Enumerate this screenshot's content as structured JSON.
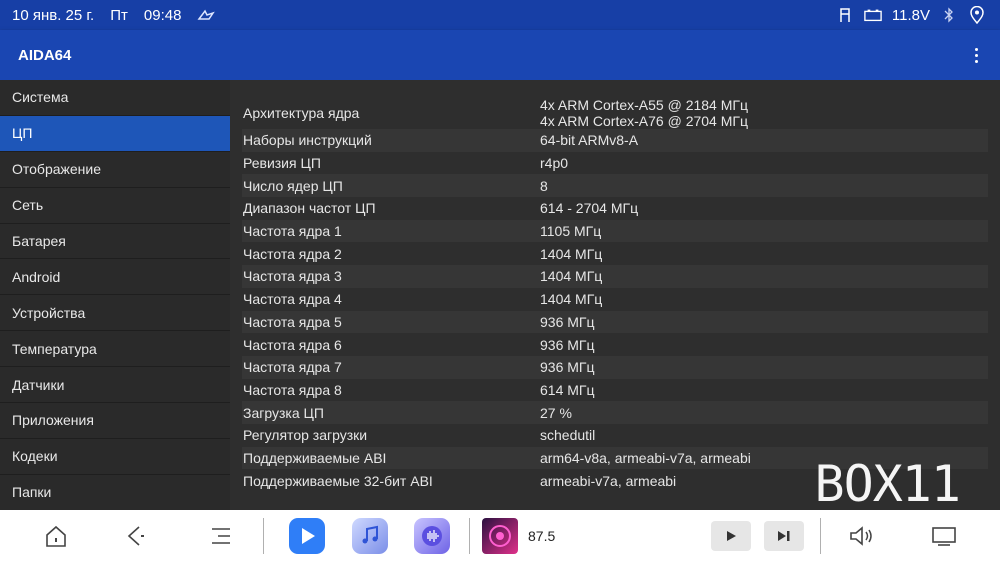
{
  "status": {
    "date": "10 янв. 25 г.",
    "weekday": "Пт",
    "time": "09:48",
    "voltage": "11.8V"
  },
  "app": {
    "title": "AIDA64"
  },
  "sidebar": {
    "items": [
      {
        "label": "Система"
      },
      {
        "label": "ЦП",
        "active": true
      },
      {
        "label": "Отображение"
      },
      {
        "label": "Сеть"
      },
      {
        "label": "Батарея"
      },
      {
        "label": "Android"
      },
      {
        "label": "Устройства"
      },
      {
        "label": "Температура"
      },
      {
        "label": "Датчики"
      },
      {
        "label": "Приложения"
      },
      {
        "label": "Кодеки"
      },
      {
        "label": "Папки"
      }
    ]
  },
  "cpu": {
    "arch_label": "Архитектура ядра",
    "arch_value_1": "4x ARM Cortex-A55 @ 2184 МГц",
    "arch_value_2": "4x ARM Cortex-A76 @ 2704 МГц",
    "rows": [
      {
        "k": "Наборы инструкций",
        "v": "64-bit ARMv8-A"
      },
      {
        "k": "Ревизия ЦП",
        "v": "r4p0"
      },
      {
        "k": "Число ядер ЦП",
        "v": "8"
      },
      {
        "k": "Диапазон частот ЦП",
        "v": "614 - 2704 МГц"
      },
      {
        "k": "Частота ядра 1",
        "v": "1105 МГц"
      },
      {
        "k": "Частота ядра 2",
        "v": "1404 МГц"
      },
      {
        "k": "Частота ядра 3",
        "v": "1404 МГц"
      },
      {
        "k": "Частота ядра 4",
        "v": "1404 МГц"
      },
      {
        "k": "Частота ядра 5",
        "v": "936 МГц"
      },
      {
        "k": "Частота ядра 6",
        "v": "936 МГц"
      },
      {
        "k": "Частота ядра 7",
        "v": "936 МГц"
      },
      {
        "k": "Частота ядра 8",
        "v": "614 МГц"
      },
      {
        "k": "Загрузка ЦП",
        "v": "27 %"
      },
      {
        "k": "Регулятор загрузки",
        "v": "schedutil"
      },
      {
        "k": "Поддерживаемые ABI",
        "v": "arm64-v8a, armeabi-v7a, armeabi"
      },
      {
        "k": "Поддерживаемые 32-бит ABI",
        "v": "armeabi-v7a, armeabi"
      }
    ]
  },
  "watermark": "BOX11",
  "navbar": {
    "radio_freq": "87.5"
  },
  "colors": {
    "status_bar": "#173fa6",
    "app_bar": "#1a46b2",
    "active_item": "#1e56b8"
  }
}
